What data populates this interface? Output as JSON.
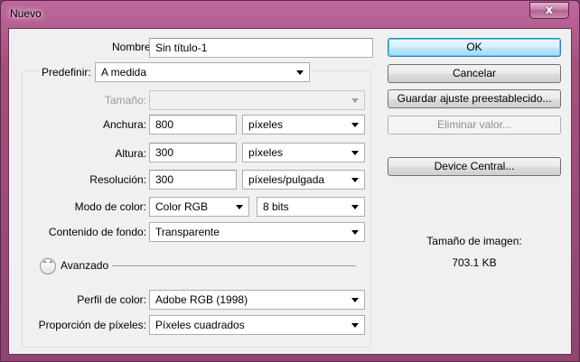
{
  "window": {
    "title": "Nuevo",
    "close_glyph": "x"
  },
  "form": {
    "nombre": {
      "label": "Nombre:",
      "value": "Sin título-1"
    },
    "predefinir": {
      "label": "Predefinir:",
      "value": "A medida"
    },
    "tamano": {
      "label": "Tamaño:",
      "value": ""
    },
    "anchura": {
      "label": "Anchura:",
      "value": "800",
      "unit": "píxeles"
    },
    "altura": {
      "label": "Altura:",
      "value": "300",
      "unit": "píxeles"
    },
    "resolucion": {
      "label": "Resolución:",
      "value": "300",
      "unit": "píxeles/pulgada"
    },
    "modo_color": {
      "label": "Modo de color:",
      "mode": "Color RGB",
      "bits": "8 bits"
    },
    "contenido_fondo": {
      "label": "Contenido de fondo:",
      "value": "Transparente"
    },
    "avanzado": {
      "label": "Avanzado",
      "toggle_glyph": "⌃⌃"
    },
    "perfil_color": {
      "label": "Perfil de color:",
      "value": "Adobe RGB (1998)"
    },
    "proporcion": {
      "label": "Proporción de píxeles:",
      "value": "Píxeles cuadrados"
    }
  },
  "buttons": {
    "ok": "OK",
    "cancelar": "Cancelar",
    "guardar": "Guardar ajuste preestablecido...",
    "eliminar": "Eliminar valor...",
    "device_central": "Device Central..."
  },
  "image_size": {
    "label": "Tamaño de imagen:",
    "value": "703.1 KB"
  }
}
